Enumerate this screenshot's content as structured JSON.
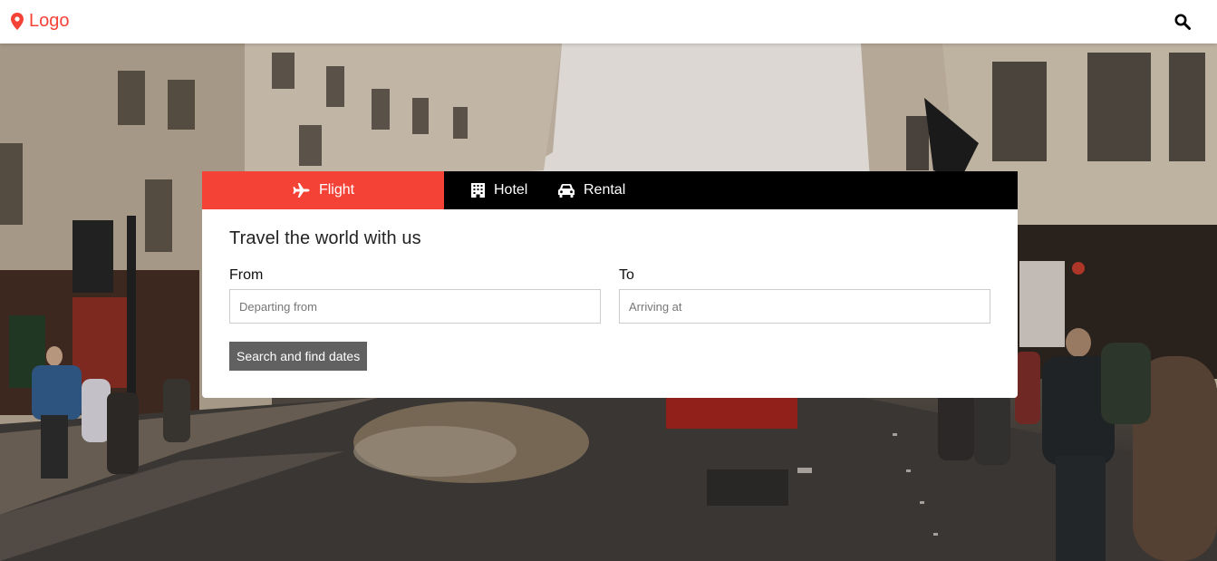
{
  "header": {
    "logo_label": "Logo",
    "brand_color": "#f44336",
    "logo_icon": "map-marker-icon",
    "search_icon": "search-icon"
  },
  "booking": {
    "tabs": [
      {
        "label": "Flight",
        "icon": "plane-icon",
        "active": true
      },
      {
        "label": "Hotel",
        "icon": "building-icon",
        "active": false
      },
      {
        "label": "Rental",
        "icon": "car-icon",
        "active": false
      }
    ],
    "title": "Travel the world with us",
    "from": {
      "label": "From",
      "placeholder": "Departing from",
      "value": ""
    },
    "to": {
      "label": "To",
      "placeholder": "Arriving at",
      "value": ""
    },
    "submit_label": "Search and find dates",
    "accent_color": "#f44336",
    "tab_bar_color": "#000000",
    "button_color": "#616161"
  }
}
